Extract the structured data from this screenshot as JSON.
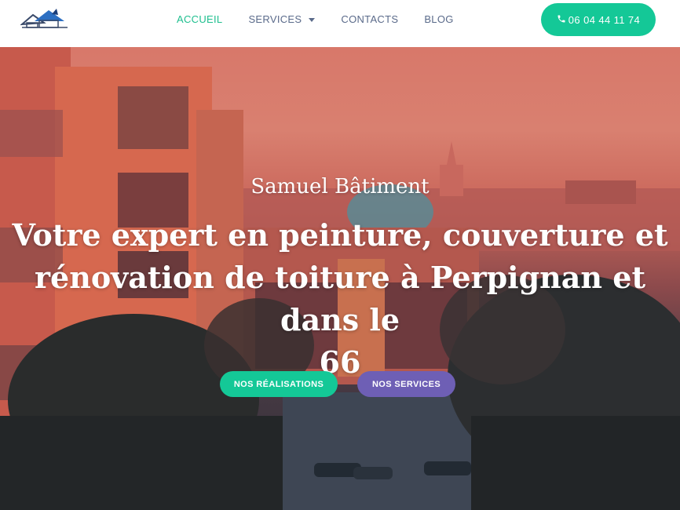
{
  "header": {
    "logo_icon": "house-roof-logo-icon",
    "nav": [
      {
        "label": "ACCUEIL",
        "active": true
      },
      {
        "label": "SERVICES",
        "active": false,
        "has_dropdown": true
      },
      {
        "label": "CONTACTS",
        "active": false
      },
      {
        "label": "BLOG",
        "active": false
      }
    ],
    "phone": {
      "icon": "phone-icon",
      "label": "06 04 44 11 74"
    }
  },
  "hero": {
    "subtitle": "Samuel Bâtiment",
    "headline_lines": [
      "Votre expert en peinture, couverture et",
      "rénovation de toiture à Perpignan et dans le",
      "66"
    ],
    "buttons": [
      {
        "label": "NOS RÉALISATIONS"
      },
      {
        "label": "NOS SERVICES"
      }
    ]
  },
  "colors": {
    "accent": "#14c897",
    "active_nav": "#1fbf8f",
    "nav_text": "#5a6a8a",
    "secondary_button": "#6e5fb5"
  }
}
